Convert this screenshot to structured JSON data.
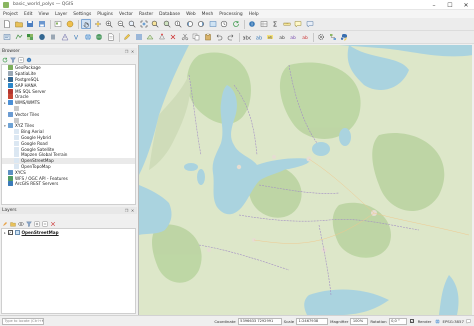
{
  "window": {
    "title": "basic_world_polys — QGIS",
    "controls": {
      "minimize": "–",
      "maximize": "☐",
      "close": "✕"
    }
  },
  "menus": [
    "Project",
    "Edit",
    "View",
    "Layer",
    "Settings",
    "Plugins",
    "Vector",
    "Raster",
    "Database",
    "Web",
    "Mesh",
    "Processing",
    "Help"
  ],
  "browser": {
    "title": "Browser",
    "items": [
      {
        "label": "GeoPackage",
        "icon": "geopackage-icon",
        "color": "#7cae5a",
        "indent": 0,
        "arrow": ""
      },
      {
        "label": "SpatiaLite",
        "icon": "spatialite-icon",
        "color": "#9aa7b4",
        "indent": 0,
        "arrow": ""
      },
      {
        "label": "PostgreSQL",
        "icon": "postgresql-icon",
        "color": "#336791",
        "indent": 0,
        "arrow": "▸"
      },
      {
        "label": "SAP HANA",
        "icon": "saphana-icon",
        "color": "#2b86c9",
        "indent": 0,
        "arrow": ""
      },
      {
        "label": "MS SQL Server",
        "icon": "mssql-icon",
        "color": "#b5352d",
        "indent": 0,
        "arrow": ""
      },
      {
        "label": "Oracle",
        "icon": "oracle-icon",
        "color": "#c74634",
        "indent": 0,
        "arrow": ""
      },
      {
        "label": "WMS/WMTS",
        "icon": "wms-icon",
        "color": "#4a8fd6",
        "indent": 0,
        "arrow": "▸"
      },
      {
        "label": "",
        "icon": "layer-icon",
        "color": "#c9c9c9",
        "indent": 1,
        "arrow": ""
      },
      {
        "label": "Vector Tiles",
        "icon": "vector-tiles-icon",
        "color": "#6b9bd2",
        "indent": 0,
        "arrow": ""
      },
      {
        "label": "",
        "icon": "layer-icon",
        "color": "#c9c9c9",
        "indent": 1,
        "arrow": ""
      },
      {
        "label": "XYZ Tiles",
        "icon": "xyz-tiles-icon",
        "color": "#6ea2d4",
        "indent": 0,
        "arrow": "▾"
      },
      {
        "label": "Bing Aerial",
        "icon": "tile-layer-icon",
        "color": "#dbe7f2",
        "indent": 1,
        "arrow": ""
      },
      {
        "label": "Google Hybrid",
        "icon": "tile-layer-icon",
        "color": "#dbe7f2",
        "indent": 1,
        "arrow": ""
      },
      {
        "label": "Google Road",
        "icon": "tile-layer-icon",
        "color": "#dbe7f2",
        "indent": 1,
        "arrow": ""
      },
      {
        "label": "Google Satellite",
        "icon": "tile-layer-icon",
        "color": "#dbe7f2",
        "indent": 1,
        "arrow": ""
      },
      {
        "label": "Mapzen Global Terrain",
        "icon": "tile-layer-icon",
        "color": "#dbe7f2",
        "indent": 1,
        "arrow": ""
      },
      {
        "label": "OpenStreetMap",
        "icon": "tile-layer-icon",
        "color": "#dbe7f2",
        "indent": 1,
        "arrow": "",
        "selected": true
      },
      {
        "label": "OpenTopoMap",
        "icon": "tile-layer-icon",
        "color": "#dbe7f2",
        "indent": 1,
        "arrow": ""
      },
      {
        "label": "XYCS",
        "icon": "xycs-icon",
        "color": "#5c8fc2",
        "indent": 0,
        "arrow": ""
      },
      {
        "label": "WFS / OGC API - Features",
        "icon": "wfs-icon",
        "color": "#4f9b62",
        "indent": 0,
        "arrow": ""
      },
      {
        "label": "ArcGIS REST Servers",
        "icon": "arcgis-icon",
        "color": "#3a7ab8",
        "indent": 0,
        "arrow": ""
      }
    ]
  },
  "layers": {
    "title": "Layers",
    "items": [
      {
        "label": "OpenStreetMap",
        "checked": "✓",
        "expand": "▸"
      }
    ]
  },
  "statusbar": {
    "locator_placeholder": "Type to locate (Ctrl+K)",
    "coordinate_label": "Coordinate",
    "coordinate_value": "5396633  7292991",
    "scale_label": "Scale",
    "scale_value": "1:2467938",
    "magnifier_label": "Magnifier",
    "magnifier_value": "100%",
    "rotation_label": "Rotation",
    "rotation_value": "0,0 °",
    "render_label": "Render",
    "render_checked": "✓",
    "crs_label": "EPSG:3857"
  },
  "colors": {
    "water": "#aad3df",
    "land": "#dde7c9",
    "forest": "#b9d39f",
    "urban": "#e6ddd2",
    "border": "#a38ec4"
  }
}
